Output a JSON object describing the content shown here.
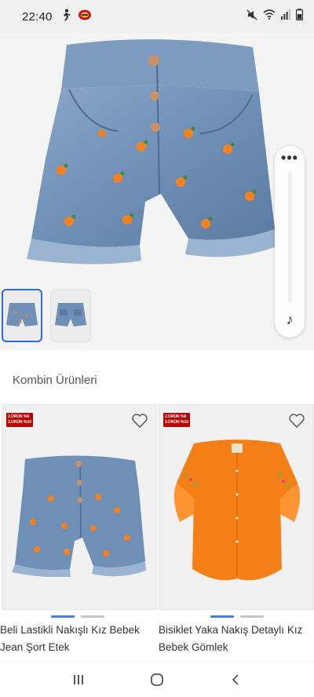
{
  "status_bar": {
    "time": "22:40",
    "icons": [
      "walking-person-icon",
      "notification-badge-icon",
      "mute-icon",
      "wifi-icon",
      "signal-icon",
      "battery-icon"
    ]
  },
  "gallery": {
    "hero_image": "denim-shorts-orange-embroidery",
    "thumbnails": [
      {
        "name": "thumbnail-front",
        "active": true
      },
      {
        "name": "thumbnail-back",
        "active": false
      }
    ],
    "floating_panel_icons": [
      "more-dots-icon",
      "music-note-icon"
    ]
  },
  "section": {
    "title": "Kombin Ürünleri"
  },
  "products": [
    {
      "badge": [
        "2.ÜRÜN %6",
        "3.ÜRÜN %10"
      ],
      "title": "Beli Lastikli Nakışlı Kız Bebek Jean Şort Etek"
    },
    {
      "badge": [
        "2.ÜRÜN %6",
        "3.ÜRÜN %10"
      ],
      "title": "Bisiklet Yaka Nakış Detaylı Kız Bebek Gömlek"
    }
  ],
  "colors": {
    "accent_blue": "#4a7fd1",
    "badge_red": "#b40000",
    "denim": "#6f8fb6",
    "orange": "#f57f17"
  },
  "nav": {
    "buttons": [
      "recent-apps-icon",
      "home-icon",
      "back-icon"
    ]
  }
}
